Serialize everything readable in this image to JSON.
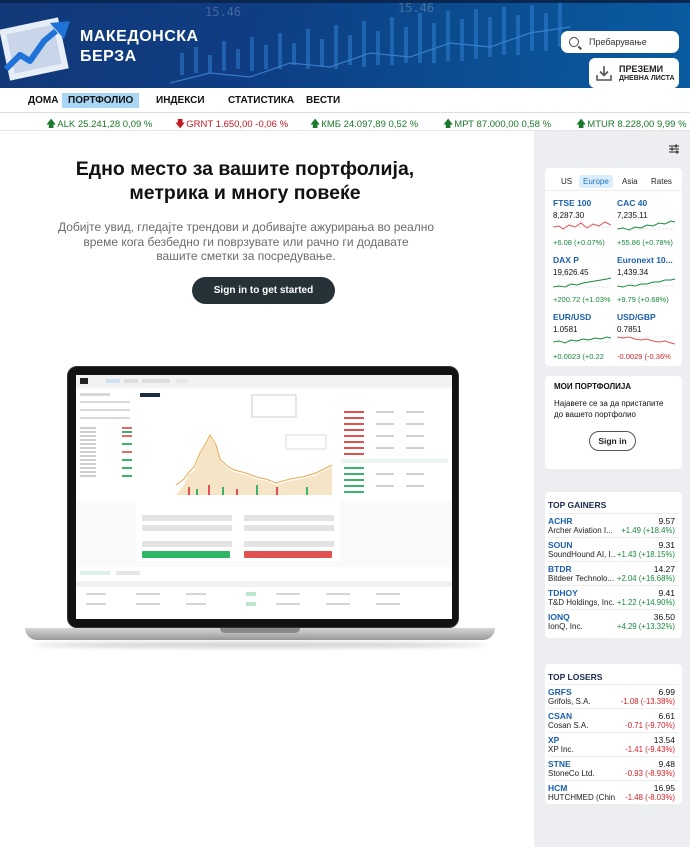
{
  "header": {
    "logo_line1": "МАКЕДОНСКА",
    "logo_line2": "БЕРЗА",
    "search_placeholder": "Пребарување",
    "download_line1": "ПРЕЗЕМИ",
    "download_line2": "ДНЕВНА ЛИСТА",
    "bg_number_1": "15.46",
    "bg_number_2": "15.46"
  },
  "nav": {
    "items": [
      "ДОМА",
      "ПОРТФОЛИО",
      "ИНДЕКСИ",
      "СТАТИСТИКА",
      "ВЕСТИ"
    ],
    "active": "ПОРТФОЛИО"
  },
  "ticker": [
    {
      "text": "ALK 25.241,28 0,09 %",
      "dir": "up"
    },
    {
      "text": "GRNT 1.650,00 -0,06 %",
      "dir": "down"
    },
    {
      "text": "КМБ 24.097,89 0,52 %",
      "dir": "up"
    },
    {
      "text": "МРТ 87.000,00 0,58 %",
      "dir": "up"
    },
    {
      "text": "MTUR 8.228,00 9,99 %",
      "dir": "up"
    }
  ],
  "hero": {
    "title_line1": "Едно место за вашите портфолија,",
    "title_line2": "метрика и многу повеќе",
    "subtitle_line1": "Добијте увид, гледајте трендови и добивајте ажурирања во  реално",
    "subtitle_line2": "време кога безбедно ги поврзувате или рачно ги  додавате",
    "subtitle_line3": "вашите сметки за посредување.",
    "cta_label": "Sign in to get started"
  },
  "markets": {
    "tabs": [
      "US",
      "Europe",
      "Asia",
      "Rates"
    ],
    "active_tab": "Europe",
    "cells": [
      {
        "name": "FTSE 100",
        "value": "8,287.30",
        "change": "+6.08 (+0.07%)",
        "dir": "up"
      },
      {
        "name": "CAC 40",
        "value": "7,235.11",
        "change": "+55.86 (+0.78%)",
        "dir": "up"
      },
      {
        "name": "DAX P",
        "value": "19,626.45",
        "change": "+200.72 (+1.03%",
        "dir": "up"
      },
      {
        "name": "Euronext 10...",
        "value": "1,439.34",
        "change": "+9.79 (+0.68%)",
        "dir": "up"
      },
      {
        "name": "EUR/USD",
        "value": "1.0581",
        "change": "+0.0023 (+0.22",
        "dir": "up"
      },
      {
        "name": "USD/GBP",
        "value": "0.7851",
        "change": "-0.0029 (-0.36%",
        "dir": "down"
      }
    ]
  },
  "portfolios": {
    "title": "МОИ ПОРТФОЛИЈА",
    "desc_line1": "Најавете се за да пристапите",
    "desc_line2": "до вашето портфолио",
    "button": "Sign in"
  },
  "gainers": {
    "title": "TOP GAINERS",
    "rows": [
      {
        "sym": "ACHR",
        "co": "Archer Aviation I...",
        "price": "9.57",
        "chg": "+1.49 (+18.4%)"
      },
      {
        "sym": "SOUN",
        "co": "SoundHound AI, I...",
        "price": "9.31",
        "chg": "+1.43 (+18.15%)"
      },
      {
        "sym": "BTDR",
        "co": "Bitdeer Technolo...",
        "price": "14.27",
        "chg": "+2.04 (+16.68%)"
      },
      {
        "sym": "TDHOY",
        "co": "T&D Holdings, Inc.",
        "price": "9.41",
        "chg": "+1.22 (+14.90%)"
      },
      {
        "sym": "IONQ",
        "co": "IonQ, Inc.",
        "price": "36.50",
        "chg": "+4.29 (+13.32%)"
      }
    ]
  },
  "losers": {
    "title": "TOP LOSERS",
    "rows": [
      {
        "sym": "GRFS",
        "co": "Grifols, S.A.",
        "price": "6.99",
        "chg": "-1.08 (-13.38%)"
      },
      {
        "sym": "CSAN",
        "co": "Cosan S.A.",
        "price": "6.61",
        "chg": "-0.71 (-9.70%)"
      },
      {
        "sym": "XP",
        "co": "XP Inc.",
        "price": "13.54",
        "chg": "-1.41 (-9.43%)"
      },
      {
        "sym": "STNE",
        "co": "StoneCo Ltd.",
        "price": "9.48",
        "chg": "-0.93 (-8.93%)"
      },
      {
        "sym": "HCM",
        "co": "HUTCHMED (Chin...",
        "price": "16.95",
        "chg": "-1.48 (-8.03%)"
      }
    ]
  },
  "colors": {
    "header_bg": "#0f3c82",
    "nav_active": "#a9d6f5",
    "up": "#17893b",
    "down": "#d21e25",
    "cta_bg": "#263238",
    "sidebar_bg": "#eceef2"
  }
}
